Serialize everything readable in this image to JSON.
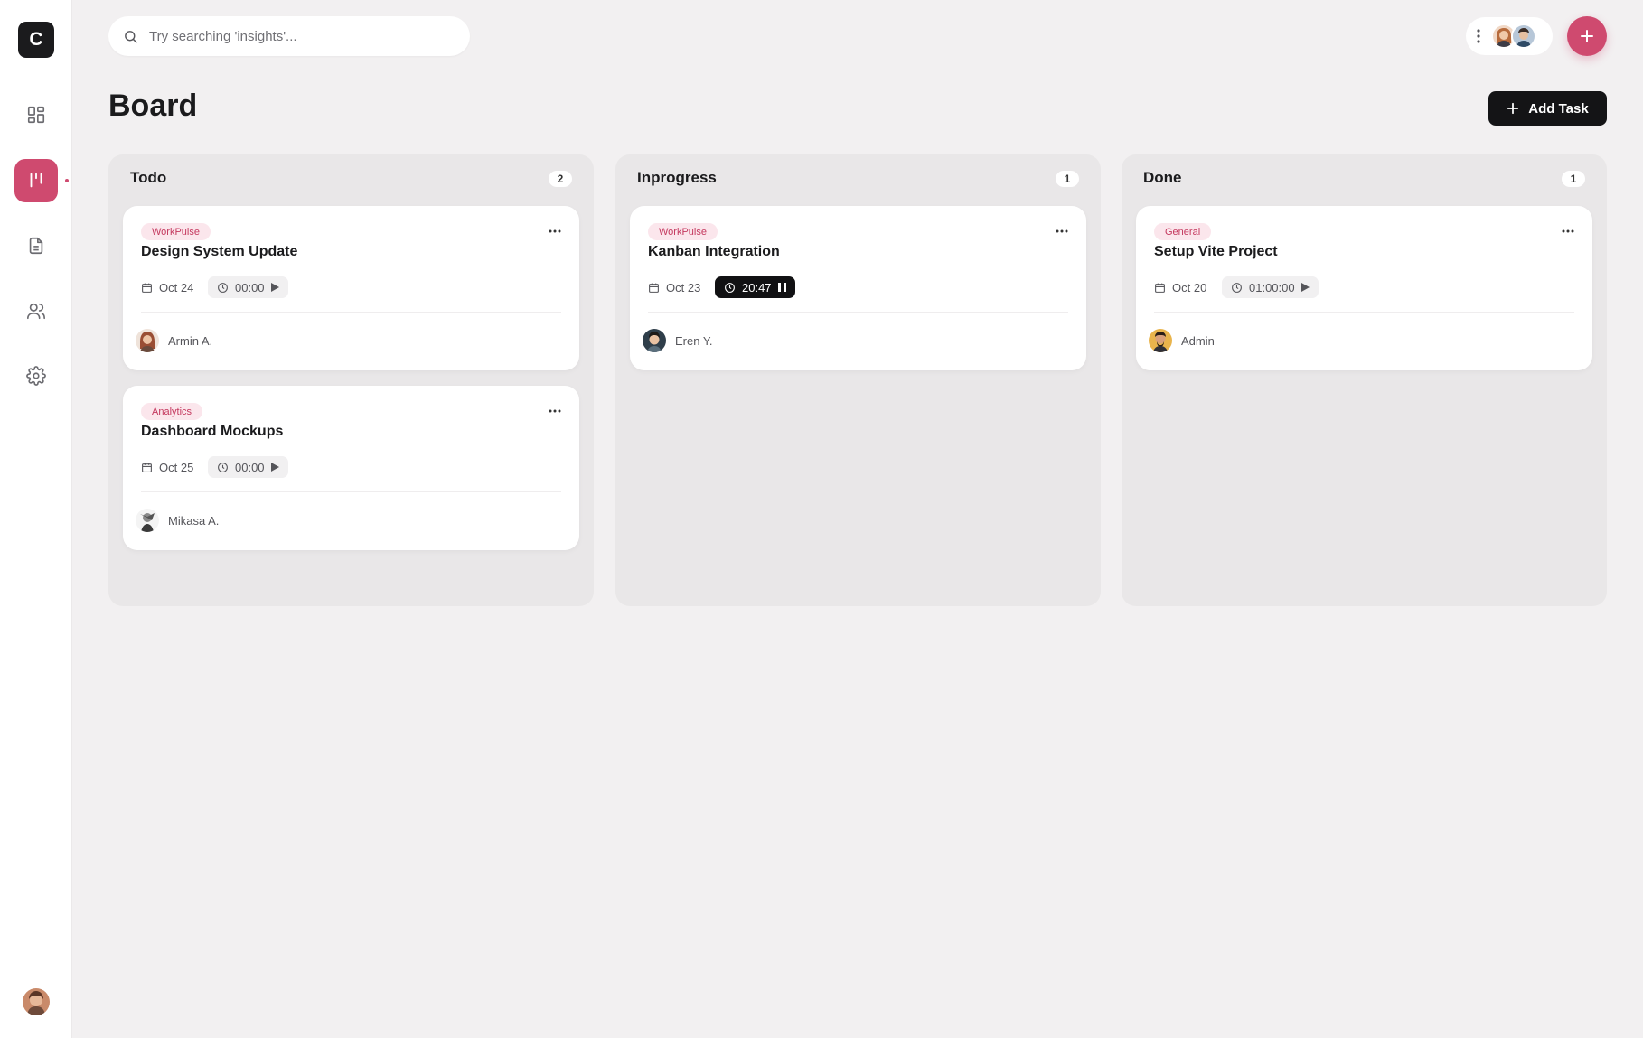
{
  "app": {
    "logo_letter": "C"
  },
  "sidebar": {
    "items": [
      {
        "name": "dashboard",
        "icon": "grid-icon"
      },
      {
        "name": "board",
        "icon": "kanban-icon",
        "active": true
      },
      {
        "name": "documents",
        "icon": "document-icon"
      },
      {
        "name": "team",
        "icon": "users-icon"
      },
      {
        "name": "settings",
        "icon": "gear-icon"
      }
    ]
  },
  "search": {
    "placeholder": "Try searching 'insights'..."
  },
  "header": {
    "title": "Board",
    "add_task_label": "Add Task"
  },
  "colors": {
    "accent": "#cf4a6f",
    "dark": "#141416",
    "tag_bg": "#fbe6ec",
    "tag_text": "#c4385e"
  },
  "columns": [
    {
      "title": "Todo",
      "count": "2",
      "cards": [
        {
          "tag": "WorkPulse",
          "title": "Design System Update",
          "date": "Oct 24",
          "timer": "00:00",
          "timer_state": "paused",
          "assignee": "Armin A."
        },
        {
          "tag": "Analytics",
          "title": "Dashboard Mockups",
          "date": "Oct 25",
          "timer": "00:00",
          "timer_state": "paused",
          "assignee": "Mikasa A."
        }
      ]
    },
    {
      "title": "Inprogress",
      "count": "1",
      "cards": [
        {
          "tag": "WorkPulse",
          "title": "Kanban Integration",
          "date": "Oct 23",
          "timer": "20:47",
          "timer_state": "running",
          "assignee": "Eren Y."
        }
      ]
    },
    {
      "title": "Done",
      "count": "1",
      "cards": [
        {
          "tag": "General",
          "title": "Setup Vite Project",
          "date": "Oct 20",
          "timer": "01:00:00",
          "timer_state": "paused",
          "assignee": "Admin"
        }
      ]
    }
  ]
}
